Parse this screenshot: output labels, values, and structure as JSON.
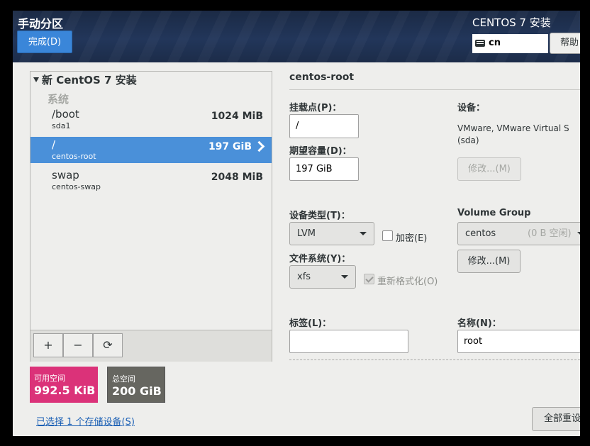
{
  "header": {
    "title": "手动分区",
    "done_label": "完成(D)",
    "product": "CENTOS 7 安装",
    "keyboard_layout": "cn",
    "help_label": "帮助"
  },
  "tree": {
    "root_label": "新 CentOS 7 安装",
    "section_label": "系统",
    "rows": [
      {
        "mount": "/boot",
        "device": "sda1",
        "size": "1024 MiB"
      },
      {
        "mount": "/",
        "device": "centos-root",
        "size": "197 GiB"
      },
      {
        "mount": "swap",
        "device": "centos-swap",
        "size": "2048 MiB"
      }
    ],
    "toolbar": {
      "add": "+",
      "remove": "−",
      "refresh": "⟳"
    }
  },
  "capacity": {
    "available_label": "可用空间",
    "available_value": "992.5 KiB",
    "total_label": "总空间",
    "total_value": "200 GiB"
  },
  "storage_link": "已选择 1 个存储设备(S)",
  "detail": {
    "partition_name": "centos-root",
    "mount_label": "挂载点(P)：",
    "mount_value": "/",
    "capacity_label": "期望容量(D)：",
    "capacity_value": "197 GiB",
    "device_label": "设备：",
    "device_value": "VMware, VMware Virtual S",
    "device_sub": "(sda)",
    "modify_label": "修改...(M)",
    "device_type_label": "设备类型(T)：",
    "device_type_value": "LVM",
    "encrypt_label": "加密(E)",
    "filesystem_label": "文件系统(Y)：",
    "filesystem_value": "xfs",
    "reformat_label": "重新格式化(O)",
    "vg_label": "Volume Group",
    "vg_value": "centos",
    "vg_free": "(0 B 空闲)",
    "vg_modify_label": "修改...(M)",
    "tag_label": "标签(L)：",
    "tag_value": "",
    "name_label": "名称(N)：",
    "name_value": "root",
    "reset_all_label": "全部重设"
  },
  "colors": {
    "selected_row": "#4a90d9",
    "available_space": "#db3279",
    "total_space": "#666660",
    "header_bg": "#1b2a45"
  }
}
